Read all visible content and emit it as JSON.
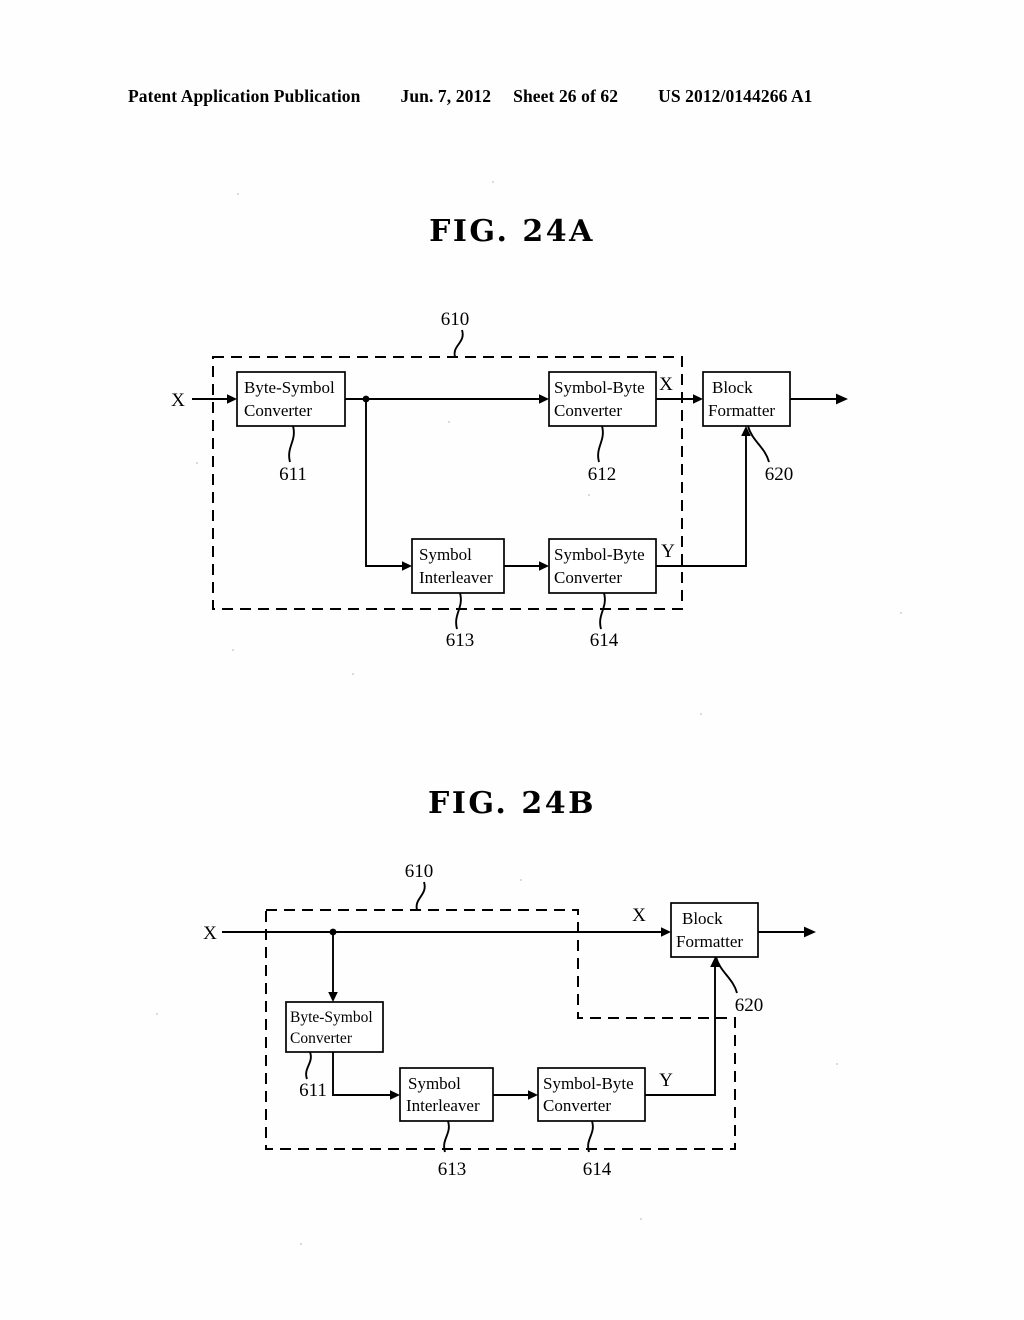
{
  "header": {
    "publication": "Patent Application Publication",
    "date": "Jun. 7, 2012",
    "sheet": "Sheet 26 of 62",
    "patent_number": "US 2012/0144266 A1"
  },
  "figures": [
    {
      "id": "fig-24a",
      "title": "FIG. 24A",
      "group_label": "610",
      "blocks": [
        {
          "ref": "611",
          "line1": "Byte-Symbol",
          "line2": "Converter"
        },
        {
          "ref": "612",
          "line1": "Symbol-Byte",
          "line2": "Converter"
        },
        {
          "ref": "613",
          "line1": "Symbol",
          "line2": "Interleaver"
        },
        {
          "ref": "614",
          "line1": "Symbol-Byte",
          "line2": "Converter"
        },
        {
          "ref": "620",
          "line1": "Block",
          "line2": "Formatter"
        }
      ],
      "signals": {
        "input": "X",
        "upper_branch": "X",
        "lower_branch": "Y"
      }
    },
    {
      "id": "fig-24b",
      "title": "FIG. 24B",
      "group_label": "610",
      "blocks": [
        {
          "ref": "611",
          "line1": "Byte-Symbol",
          "line2": "Converter"
        },
        {
          "ref": "613",
          "line1": "Symbol",
          "line2": "Interleaver"
        },
        {
          "ref": "614",
          "line1": "Symbol-Byte",
          "line2": "Converter"
        },
        {
          "ref": "620",
          "line1": "Block",
          "line2": "Formatter"
        }
      ],
      "signals": {
        "input": "X",
        "upper_branch": "X",
        "lower_branch": "Y"
      }
    }
  ]
}
